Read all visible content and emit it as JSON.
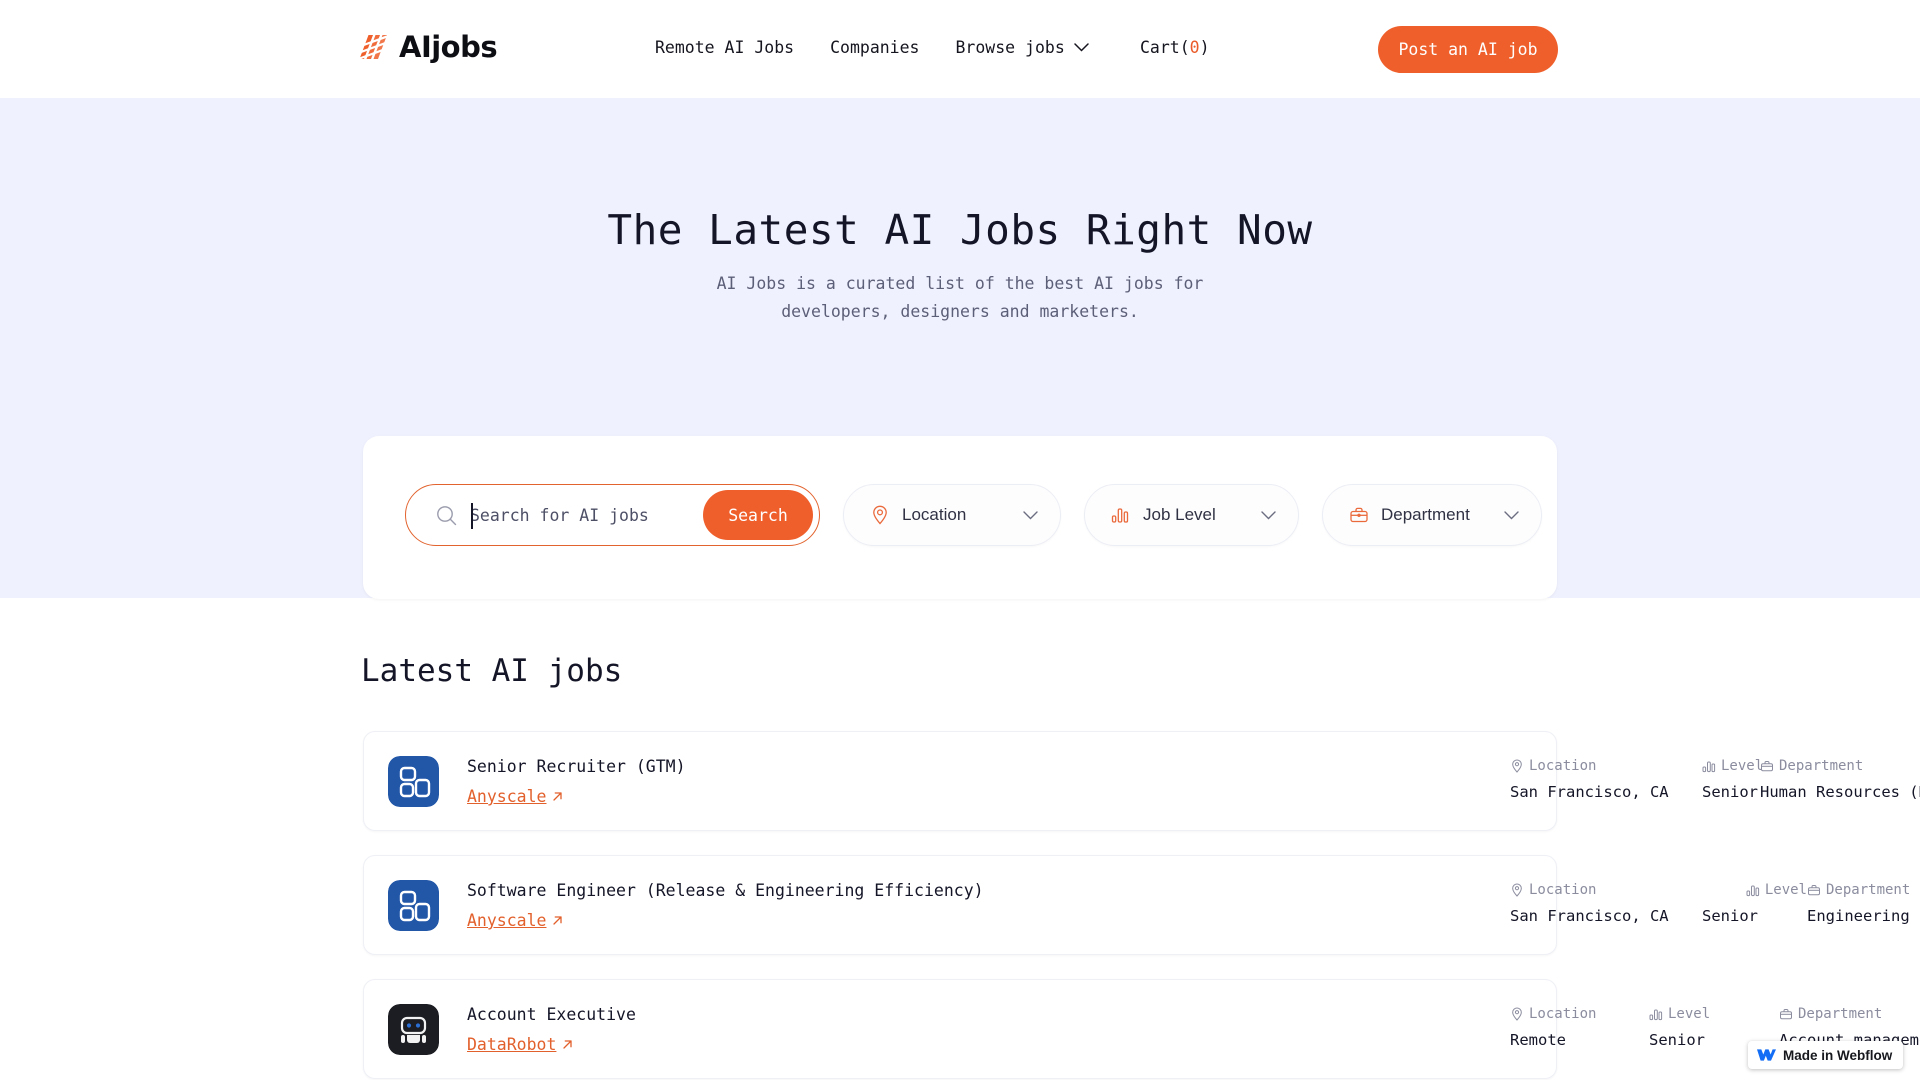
{
  "brand": {
    "name": "AIjobs",
    "accent": "#ef5f2b",
    "logo_icon": "aijobs-stripes-logo"
  },
  "header": {
    "nav": [
      {
        "label": "Remote AI Jobs",
        "name": "nav-remote-ai-jobs"
      },
      {
        "label": "Companies",
        "name": "nav-companies"
      },
      {
        "label": "Browse jobs",
        "name": "nav-browse-jobs",
        "has_chevron": true
      }
    ],
    "cart_label": "Cart(",
    "cart_count": "0",
    "cart_close": ")",
    "post_button": "Post an AI job"
  },
  "hero": {
    "title": "The Latest AI Jobs Right Now",
    "subtitle": "AI Jobs is a curated list of the best AI jobs for developers, designers and marketers."
  },
  "search": {
    "placeholder": "Search for AI jobs",
    "value": "",
    "button_label": "Search",
    "filters": [
      {
        "label": "Location",
        "icon": "map-pin-icon",
        "name": "filter-location"
      },
      {
        "label": "Job Level",
        "icon": "bar-chart-icon",
        "name": "filter-job-level"
      },
      {
        "label": "Department",
        "icon": "briefcase-icon",
        "name": "filter-department"
      }
    ]
  },
  "jobs_section": {
    "heading": "Latest AI jobs",
    "meta_labels": {
      "location": "Location",
      "level": "Level",
      "department": "Department"
    },
    "items": [
      {
        "title": "Senior Recruiter (GTM)",
        "company": "Anyscale",
        "logo": "anyscale-logo",
        "location": "San Francisco, CA",
        "level": "Senior",
        "department": "Human Resources (HR)"
      },
      {
        "title": "Software Engineer (Release & Engineering Efficiency)",
        "company": "Anyscale",
        "logo": "anyscale-logo",
        "location": "San Francisco, CA",
        "level": "Senior",
        "department": "Engineering"
      },
      {
        "title": "Account Executive",
        "company": "DataRobot",
        "logo": "datarobot-logo",
        "location": "Remote",
        "level": "Senior",
        "department": "Account management"
      }
    ]
  },
  "webflow_badge": {
    "text": "Made in Webflow",
    "icon": "webflow-logo"
  }
}
